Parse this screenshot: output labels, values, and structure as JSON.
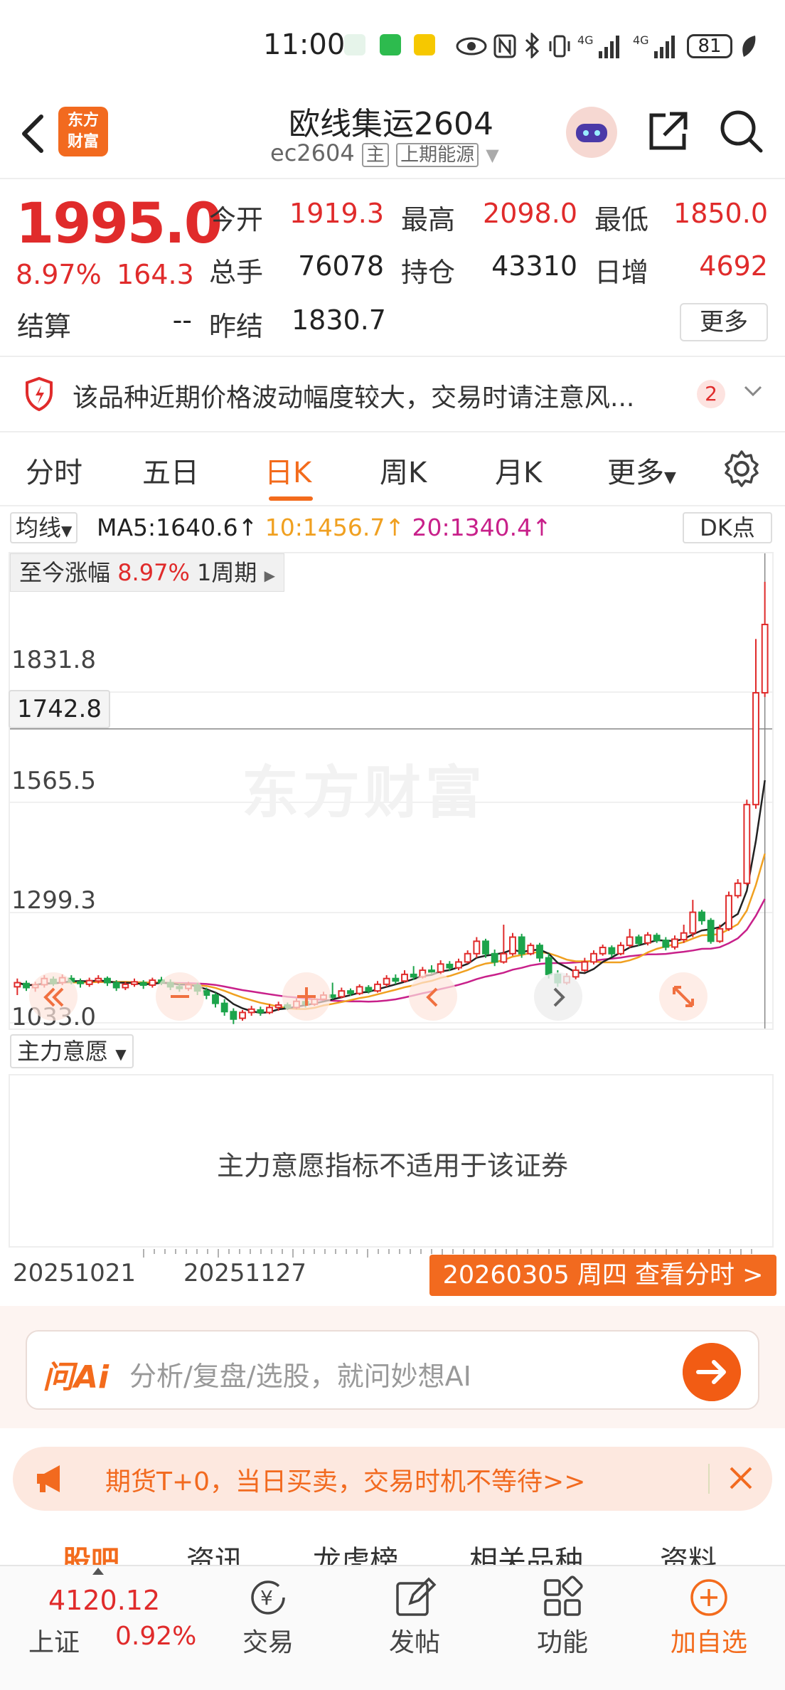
{
  "status_bar": {
    "time": "11:00",
    "battery": "81"
  },
  "header": {
    "title": "欧线集运2604",
    "code": "ec2604",
    "main_tag": "主",
    "exchange": "上期能源",
    "logo_text": "东方财富"
  },
  "quote": {
    "price": "1995.0",
    "change_pct": "8.97%",
    "change": "164.3",
    "open_label": "今开",
    "open": "1919.3",
    "high_label": "最高",
    "high": "2098.0",
    "low_label": "最低",
    "low": "1850.0",
    "volume_label": "总手",
    "volume": "76078",
    "oi_label": "持仓",
    "oi": "43310",
    "daily_inc_label": "日增",
    "daily_inc": "4692",
    "settle_label": "结算",
    "settle": "--",
    "prev_settle_label": "昨结",
    "prev_settle": "1830.7",
    "more": "更多"
  },
  "warning": {
    "text": "该品种近期价格波动幅度较大，交易时请注意风...",
    "count": "2"
  },
  "tabs": [
    "分时",
    "五日",
    "日K",
    "周K",
    "月K",
    "更多"
  ],
  "active_tab": 2,
  "ma_bar": {
    "select": "均线",
    "ma5": "MA5:1640.6↑",
    "ma10": "10:1456.7↑",
    "ma20": "20:1340.4↑",
    "dk": "DK点"
  },
  "colors": {
    "up": "#e02b2b",
    "down": "#1ca44b",
    "ma5": "#222222",
    "ma10": "#f0a020",
    "ma20": "#c8208a",
    "accent": "#f36b1c"
  },
  "chart_data": {
    "type": "candlestick",
    "badge": {
      "label": "至今涨幅",
      "value": "8.97%",
      "period": "1周期"
    },
    "crosshair_value": "1742.8",
    "y_ticks": [
      "1831.8",
      "1565.5",
      "1299.3",
      "1033.0"
    ],
    "ylim": [
      1033.0,
      2098.0
    ],
    "x_labels": [
      "20251021",
      "20251127"
    ],
    "date_button": "20260305 周四 查看分时 >",
    "watermark": "东方财富",
    "candles": [
      [
        1120,
        1130,
        1100,
        1140
      ],
      [
        1128,
        1118,
        1110,
        1135
      ],
      [
        1118,
        1125,
        1108,
        1132
      ],
      [
        1125,
        1140,
        1118,
        1148
      ],
      [
        1138,
        1128,
        1122,
        1145
      ],
      [
        1130,
        1142,
        1124,
        1150
      ],
      [
        1140,
        1132,
        1126,
        1148
      ],
      [
        1132,
        1128,
        1118,
        1140
      ],
      [
        1126,
        1135,
        1120,
        1142
      ],
      [
        1134,
        1140,
        1128,
        1148
      ],
      [
        1140,
        1130,
        1122,
        1145
      ],
      [
        1130,
        1118,
        1110,
        1136
      ],
      [
        1118,
        1126,
        1112,
        1132
      ],
      [
        1126,
        1132,
        1120,
        1140
      ],
      [
        1130,
        1124,
        1115,
        1136
      ],
      [
        1124,
        1136,
        1118,
        1142
      ],
      [
        1136,
        1130,
        1124,
        1144
      ],
      [
        1130,
        1120,
        1112,
        1138
      ],
      [
        1120,
        1116,
        1108,
        1128
      ],
      [
        1116,
        1125,
        1110,
        1132
      ],
      [
        1124,
        1110,
        1100,
        1130
      ],
      [
        1110,
        1100,
        1090,
        1118
      ],
      [
        1100,
        1080,
        1070,
        1106
      ],
      [
        1080,
        1060,
        1050,
        1090
      ],
      [
        1060,
        1042,
        1030,
        1068
      ],
      [
        1044,
        1058,
        1038,
        1064
      ],
      [
        1058,
        1066,
        1050,
        1074
      ],
      [
        1064,
        1058,
        1050,
        1072
      ],
      [
        1058,
        1070,
        1054,
        1078
      ],
      [
        1070,
        1076,
        1062,
        1084
      ],
      [
        1076,
        1070,
        1064,
        1082
      ],
      [
        1070,
        1085,
        1066,
        1092
      ],
      [
        1084,
        1078,
        1070,
        1090
      ],
      [
        1078,
        1090,
        1074,
        1096
      ],
      [
        1090,
        1100,
        1086,
        1108
      ],
      [
        1100,
        1095,
        1090,
        1130
      ],
      [
        1096,
        1110,
        1092,
        1118
      ],
      [
        1110,
        1104,
        1098,
        1116
      ],
      [
        1104,
        1120,
        1100,
        1126
      ],
      [
        1118,
        1110,
        1104,
        1124
      ],
      [
        1110,
        1126,
        1106,
        1134
      ],
      [
        1126,
        1140,
        1120,
        1148
      ],
      [
        1140,
        1134,
        1126,
        1150
      ],
      [
        1134,
        1150,
        1130,
        1160
      ],
      [
        1150,
        1144,
        1136,
        1170
      ],
      [
        1144,
        1160,
        1140,
        1168
      ],
      [
        1160,
        1156,
        1150,
        1172
      ],
      [
        1156,
        1175,
        1150,
        1184
      ],
      [
        1174,
        1166,
        1158,
        1182
      ],
      [
        1166,
        1180,
        1160,
        1188
      ],
      [
        1180,
        1200,
        1176,
        1208
      ],
      [
        1200,
        1230,
        1190,
        1240
      ],
      [
        1230,
        1200,
        1190,
        1236
      ],
      [
        1200,
        1180,
        1170,
        1210
      ],
      [
        1180,
        1200,
        1176,
        1270
      ],
      [
        1200,
        1240,
        1195,
        1250
      ],
      [
        1240,
        1200,
        1190,
        1248
      ],
      [
        1200,
        1220,
        1196,
        1226
      ],
      [
        1220,
        1190,
        1180,
        1226
      ],
      [
        1190,
        1150,
        1140,
        1200
      ],
      [
        1150,
        1130,
        1120,
        1160
      ],
      [
        1130,
        1145,
        1125,
        1152
      ],
      [
        1144,
        1160,
        1138,
        1170
      ],
      [
        1160,
        1180,
        1156,
        1190
      ],
      [
        1180,
        1200,
        1174,
        1208
      ],
      [
        1200,
        1215,
        1195,
        1222
      ],
      [
        1214,
        1200,
        1192,
        1220
      ],
      [
        1200,
        1220,
        1196,
        1228
      ],
      [
        1220,
        1240,
        1214,
        1260
      ],
      [
        1240,
        1225,
        1218,
        1246
      ],
      [
        1226,
        1245,
        1220,
        1252
      ],
      [
        1244,
        1232,
        1226,
        1250
      ],
      [
        1232,
        1216,
        1208,
        1240
      ],
      [
        1216,
        1235,
        1210,
        1244
      ],
      [
        1234,
        1250,
        1226,
        1270
      ],
      [
        1250,
        1300,
        1240,
        1330
      ],
      [
        1300,
        1280,
        1270,
        1306
      ],
      [
        1280,
        1230,
        1224,
        1286
      ],
      [
        1230,
        1260,
        1226,
        1270
      ],
      [
        1260,
        1340,
        1255,
        1350
      ],
      [
        1340,
        1370,
        1334,
        1380
      ],
      [
        1370,
        1560,
        1365,
        1572
      ],
      [
        1560,
        1830,
        1550,
        1960
      ],
      [
        1830,
        1995,
        1820,
        2098
      ]
    ]
  },
  "indicator": {
    "select": "主力意愿",
    "message": "主力意愿指标不适用于该证券"
  },
  "ai_bar": {
    "logo": "问Ai",
    "placeholder": "分析/复盘/选股，就问妙想AI"
  },
  "promo": {
    "text": "期货T+0，当日买卖，交易时机不等待>>"
  },
  "subtabs": [
    "股吧",
    "资讯",
    "龙虎榜",
    "相关品种",
    "资料"
  ],
  "bottom_nav": {
    "index_value": "4120.12",
    "index_name": "上证",
    "index_pct": "0.92%",
    "items": [
      "交易",
      "发帖",
      "功能",
      "加自选"
    ]
  }
}
